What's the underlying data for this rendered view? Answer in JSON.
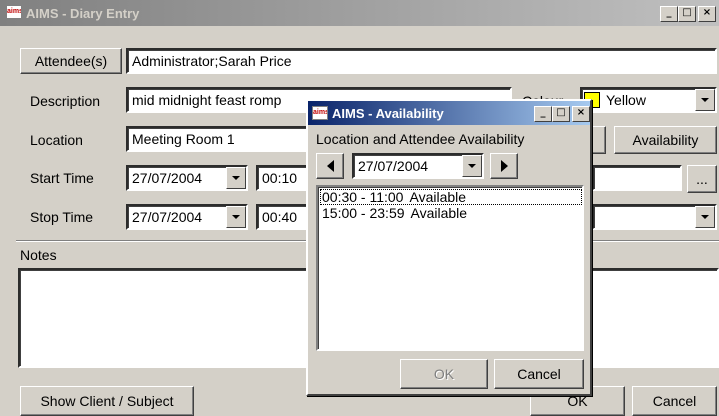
{
  "main_window": {
    "title": "AIMS - Diary Entry",
    "icon_text": "aims",
    "caption_buttons": [
      "_",
      "□",
      "×"
    ],
    "attendees_button": "Attendee(s)",
    "attendees_value": "Administrator;Sarah Price",
    "description_label": "Description",
    "description_value": "mid midnight feast romp",
    "colour_label": "Colour",
    "colour_value": "Yellow",
    "location_label": "Location",
    "location_value": "Meeting Room 1",
    "availability_button": "Availability",
    "start_time_label": "Start Time",
    "start_date": "27/07/2004",
    "start_time": "00:10",
    "ellipsis_button": "...",
    "stop_time_label": "Stop Time",
    "stop_date": "27/07/2004",
    "stop_time": "00:40",
    "notes_label": "Notes",
    "notes_value": "",
    "show_client_button": "Show Client / Subject",
    "ok_button": "OK",
    "cancel_button": "Cancel"
  },
  "availability_dialog": {
    "title": "AIMS - Availability",
    "icon_text": "aims",
    "caption_buttons": [
      "_",
      "□",
      "×"
    ],
    "heading": "Location and Attendee Availability",
    "date_value": "27/07/2004",
    "slots": [
      {
        "range": "00:30 - 11:00",
        "status": "Available"
      },
      {
        "range": "15:00 - 23:59",
        "status": "Available"
      }
    ],
    "ok_button": "OK",
    "cancel_button": "Cancel"
  },
  "colors": {
    "inactive_title_start": "#808080",
    "inactive_title_end": "#c0c0c0",
    "active_title_start": "#0a246a",
    "active_title_end": "#a6caf0",
    "face": "#d4d0c8",
    "colour_swatch": "#ffff00"
  }
}
